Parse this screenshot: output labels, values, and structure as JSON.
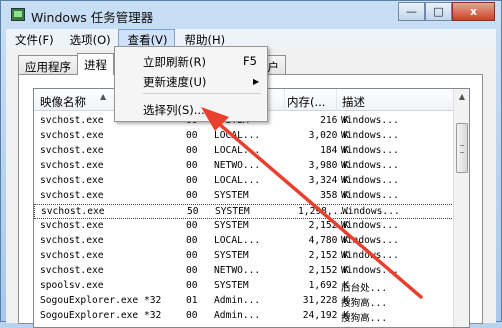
{
  "window": {
    "title": "Windows 任务管理器"
  },
  "title_buttons": {
    "minimize": "—",
    "maximize": "□",
    "close": "x"
  },
  "menubar": [
    {
      "label": "文件(F)"
    },
    {
      "label": "选项(O)"
    },
    {
      "label": "查看(V)",
      "active": true
    },
    {
      "label": "帮助(H)"
    }
  ],
  "tabs": [
    {
      "label": "应用程序"
    },
    {
      "label": "进程",
      "selected": true
    },
    {
      "label": "用户"
    }
  ],
  "view_menu": {
    "items": [
      {
        "label": "立即刷新(R)",
        "shortcut": "F5"
      },
      {
        "label": "更新速度(U)",
        "submenu_icon": "submenu-arrow-icon"
      },
      {
        "label": "选择列(S)..."
      }
    ]
  },
  "table": {
    "headers": {
      "name": "映像名称",
      "memory": "内存(...",
      "description": "描述"
    },
    "rows": [
      {
        "name": "svchost.exe",
        "cpu": "00",
        "user": "SYSTEM",
        "mem": "216 K",
        "desc": "Windows..."
      },
      {
        "name": "svchost.exe",
        "cpu": "00",
        "user": "LOCAL...",
        "mem": "3,020 K",
        "desc": "Windows..."
      },
      {
        "name": "svchost.exe",
        "cpu": "00",
        "user": "LOCAL...",
        "mem": "184 K",
        "desc": "Windows..."
      },
      {
        "name": "svchost.exe",
        "cpu": "00",
        "user": "NETWO...",
        "mem": "3,980 K",
        "desc": "Windows..."
      },
      {
        "name": "svchost.exe",
        "cpu": "00",
        "user": "LOCAL...",
        "mem": "3,324 K",
        "desc": "Windows..."
      },
      {
        "name": "svchost.exe",
        "cpu": "00",
        "user": "SYSTEM",
        "mem": "358 K",
        "desc": "Windows..."
      },
      {
        "name": "svchost.exe",
        "cpu": "50",
        "user": "SYSTEM",
        "mem": "1,298,...",
        "desc": "Windows...",
        "selected": true
      },
      {
        "name": "svchost.exe",
        "cpu": "00",
        "user": "SYSTEM",
        "mem": "2,152 K",
        "desc": "Windows..."
      },
      {
        "name": "svchost.exe",
        "cpu": "00",
        "user": "LOCAL...",
        "mem": "4,780 K",
        "desc": "Windows..."
      },
      {
        "name": "svchost.exe",
        "cpu": "00",
        "user": "SYSTEM",
        "mem": "2,152 K",
        "desc": "Windows..."
      },
      {
        "name": "svchost.exe",
        "cpu": "00",
        "user": "NETWO...",
        "mem": "2,152 K",
        "desc": "Windows..."
      },
      {
        "name": "spoolsv.exe",
        "cpu": "00",
        "user": "SYSTEM",
        "mem": "1,692 K",
        "desc": "后台处..."
      },
      {
        "name": "SogouExplorer.exe *32",
        "cpu": "01",
        "user": "Admin...",
        "mem": "31,228 K",
        "desc": "搜狗高..."
      },
      {
        "name": "SogouExplorer.exe *32",
        "cpu": "00",
        "user": "Admin...",
        "mem": "24,192 K",
        "desc": "搜狗高..."
      }
    ]
  },
  "annotation": {
    "arrow_color": "#e8402c"
  }
}
